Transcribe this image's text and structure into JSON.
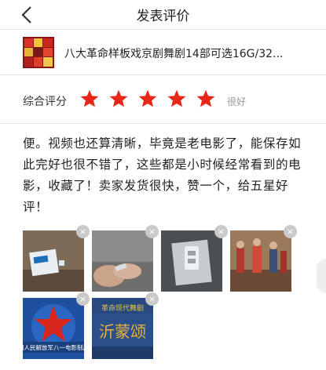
{
  "header": {
    "title": "发表评价",
    "back_icon": "chevron-left-icon"
  },
  "product": {
    "name": "八大革命样板戏京剧舞剧14部可选16G/32...",
    "thumbnail_icon": "product-thumbnail"
  },
  "rating": {
    "label": "综合评分",
    "stars": 5,
    "max_stars": 5,
    "star_color": "#e8271b",
    "text": "很好"
  },
  "review": {
    "text": "便。视频也还算清晰，毕竟是老电影了，能保存如此完好也很不错了，这些都是小时候经常看到的电影，收藏了！卖家发货很快，赞一个，给五星好评！"
  },
  "photos": {
    "remove_glyph": "×",
    "items": [
      {
        "name": "photo-usb-card-with-drive"
      },
      {
        "name": "photo-usb-drive-in-hand"
      },
      {
        "name": "photo-usb-drive-closeup"
      },
      {
        "name": "photo-opera-dancers"
      },
      {
        "name": "photo-red-star-film-logo",
        "caption": "国人民解放军八一电影制片"
      },
      {
        "name": "photo-opera-title-card",
        "caption_top": "革命现代舞剧",
        "caption_main": "沂蒙颂"
      }
    ]
  }
}
